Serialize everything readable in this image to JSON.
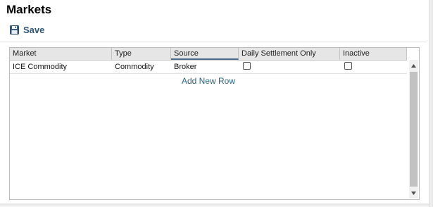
{
  "page": {
    "title": "Markets"
  },
  "toolbar": {
    "save_label": "Save",
    "save_icon": "save-floppy-icon"
  },
  "grid": {
    "columns": [
      "Market",
      "Type",
      "Source",
      "Daily Settlement Only",
      "Inactive"
    ],
    "sorted_column": "Source",
    "rows": [
      {
        "market": "ICE Commodity",
        "type": "Commodity",
        "source": "Broker",
        "daily_settlement_only": false,
        "inactive": false
      }
    ],
    "add_row_label": "Add New Row"
  },
  "colors": {
    "accent": "#2d5577",
    "link": "#2b6682",
    "header_bg": "#e6e6e6"
  }
}
